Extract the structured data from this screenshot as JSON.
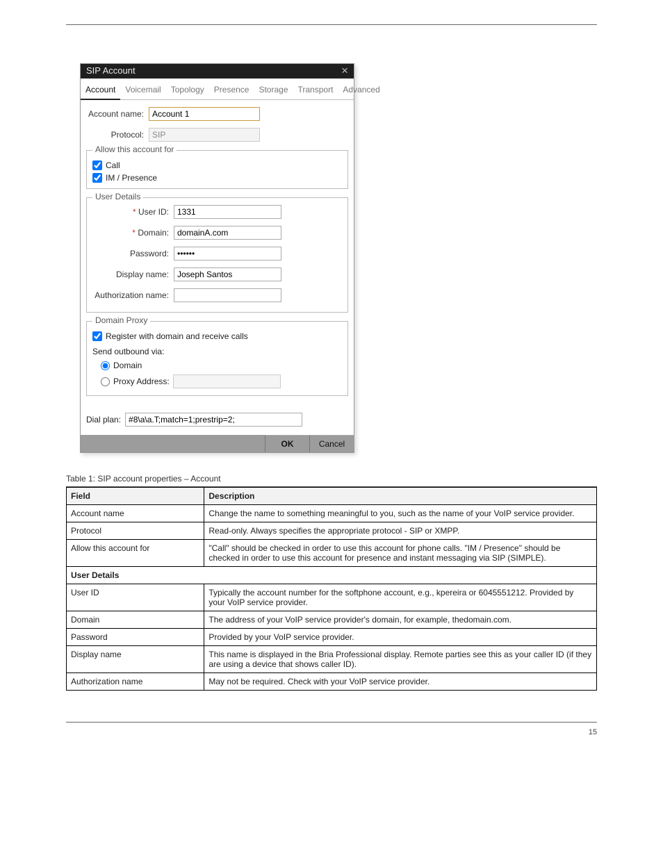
{
  "dialog": {
    "title": "SIP Account",
    "tabs": [
      "Account",
      "Voicemail",
      "Topology",
      "Presence",
      "Storage",
      "Transport",
      "Advanced"
    ],
    "account_name_label": "Account name:",
    "account_name": "Account 1",
    "protocol_label": "Protocol:",
    "protocol": "SIP",
    "allow_legend": "Allow this account for",
    "allow_call": "Call",
    "allow_im": "IM / Presence",
    "user_details_legend": "User Details",
    "user_id_label": "User ID:",
    "user_id": "1331",
    "domain_label": "Domain:",
    "domain": "domainA.com",
    "password_label": "Password:",
    "password": "••••••",
    "display_name_label": "Display name:",
    "display_name": "Joseph Santos",
    "auth_name_label": "Authorization name:",
    "auth_name": "",
    "proxy_legend": "Domain Proxy",
    "register_label": "Register with domain and receive calls",
    "send_via_label": "Send outbound via:",
    "radio_domain": "Domain",
    "radio_proxy": "Proxy  Address:",
    "proxy_addr": "",
    "dialplan_label": "Dial plan:",
    "dialplan": "#8\\a\\a.T;match=1;prestrip=2;",
    "ok": "OK",
    "cancel": "Cancel"
  },
  "table": {
    "caption": "Table 1: SIP account properties – Account",
    "col_field": "Field",
    "col_desc": "Description",
    "rows": [
      {
        "f": "Account name",
        "d": "Change the name to something meaningful to you, such as the name of your VoIP service provider."
      },
      {
        "f": "Protocol",
        "d": "Read-only. Always specifies the appropriate protocol - SIP or XMPP."
      },
      {
        "f": "Allow this account for",
        "d": "\"Call\" should be checked in order to use this account for phone calls. \"IM / Presence\" should be checked in order to use this account for presence and instant messaging via SIP (SIMPLE)."
      },
      {
        "f": "User Details",
        "d": "",
        "section": true
      },
      {
        "f": "User ID",
        "d": "Typically the account number for the softphone account, e.g., kpereira or 6045551212. Provided by your VoIP service provider."
      },
      {
        "f": "Domain",
        "d": "The address of your VoIP service provider's domain, for example, thedomain.com."
      },
      {
        "f": "Password",
        "d": "Provided by your VoIP service provider."
      },
      {
        "f": "Display name",
        "d": "This name is displayed in the Bria Professional display. Remote parties see this as your caller ID (if they are using a device that shows caller ID)."
      },
      {
        "f": "Authorization name",
        "d": "May not be required. Check with your VoIP service provider."
      }
    ]
  },
  "footer": "15"
}
